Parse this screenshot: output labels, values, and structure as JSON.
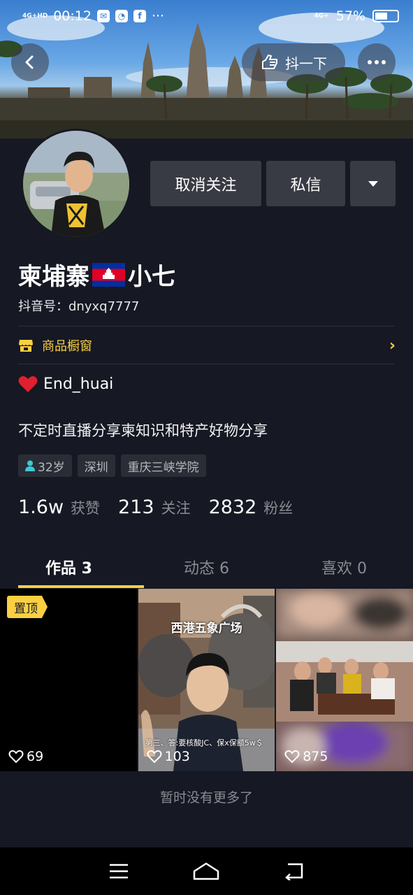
{
  "status_bar": {
    "network": "4G+HD",
    "time": "00:12",
    "signal_right": "4G+",
    "battery_percent": "57%",
    "battery_level": 0.57
  },
  "header": {
    "back_icon": "chevron-left-icon",
    "dou_label": "抖一下",
    "more_icon": "ellipsis-icon"
  },
  "actions": {
    "unfollow_label": "取消关注",
    "message_label": "私信",
    "dropdown_icon": "caret-down-icon"
  },
  "profile": {
    "name_part1": "柬埔寨",
    "name_part2": "小七",
    "douyin_id": "抖音号：dnyxq7777",
    "shop_label": "商品橱窗",
    "signature": "End_huai",
    "bio": "不定时直播分享柬知识和特产好物分享",
    "tags": {
      "age": "32岁",
      "city": "深圳",
      "school": "重庆三峡学院"
    }
  },
  "stats": {
    "likes_num": "1.6w",
    "likes_label": "获赞",
    "following_num": "213",
    "following_label": "关注",
    "followers_num": "2832",
    "followers_label": "粉丝"
  },
  "tabs": {
    "works": "作品 3",
    "activity": "动态 6",
    "likes": "喜欢 0"
  },
  "videos": {
    "pinned_label": "置顶",
    "v1_likes": "69",
    "v2_likes": "103",
    "v2_title": "西港五象广场",
    "v2_caption": "第三、答:要核酸JC、保x保额5w＄",
    "v3_likes": "875"
  },
  "footer": {
    "no_more": "暂时没有更多了"
  },
  "colors": {
    "background": "#161823",
    "accent": "#facf41",
    "button": "#393b44"
  }
}
